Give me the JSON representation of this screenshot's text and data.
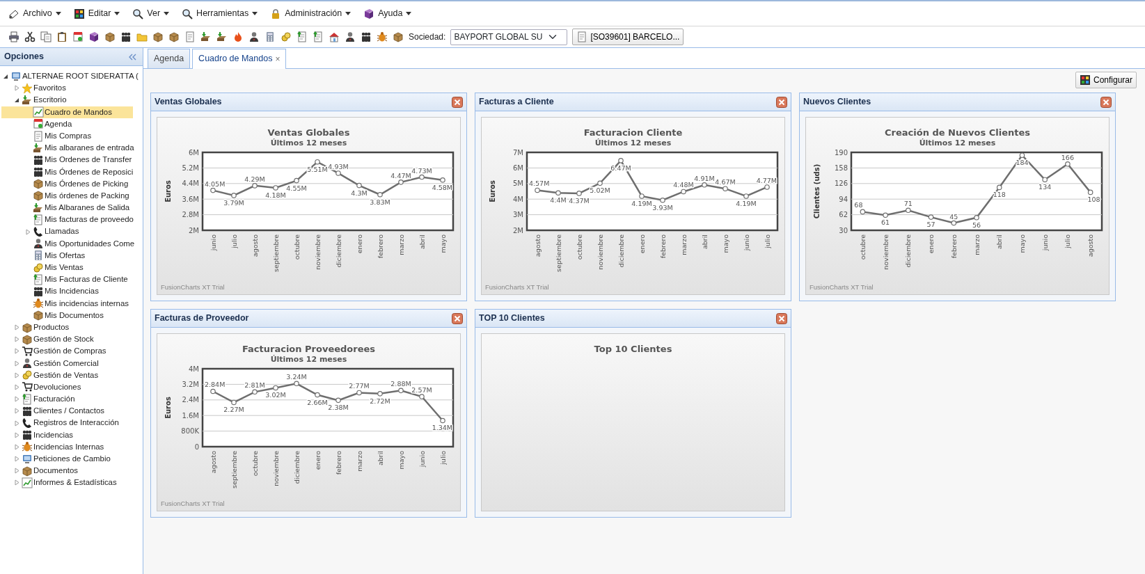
{
  "menu": [
    {
      "label": "Archivo"
    },
    {
      "label": "Editar"
    },
    {
      "label": "Ver"
    },
    {
      "label": "Herramientas"
    },
    {
      "label": "Administración"
    },
    {
      "label": "Ayuda"
    }
  ],
  "toolbar": {
    "company_label": "Sociedad:",
    "company_value": "BAYPORT GLOBAL SU",
    "document_button": "[SO39601] BARCELO..."
  },
  "sidebar": {
    "title": "Opciones",
    "tree": [
      {
        "label": "ALTERNAE ROOT SIDERATTA (",
        "expanded": true,
        "selected": false,
        "children": [
          {
            "label": "Favoritos",
            "expanded": false,
            "selected": false
          },
          {
            "label": "Escritorio",
            "expanded": true,
            "selected": false,
            "children": [
              {
                "label": "Cuadro de Mandos",
                "selected": true
              },
              {
                "label": "Agenda",
                "selected": false
              },
              {
                "label": "Mis Compras",
                "selected": false
              },
              {
                "label": "Mis albaranes de entrada",
                "selected": false
              },
              {
                "label": "Mis Ordenes de Transfer",
                "selected": false
              },
              {
                "label": "Mis Órdenes de Reposici",
                "selected": false
              },
              {
                "label": "Mis Órdenes de Picking",
                "selected": false
              },
              {
                "label": "Mis órdenes de Packing",
                "selected": false
              },
              {
                "label": "Mis Albaranes de Salida",
                "selected": false
              },
              {
                "label": "Mis facturas de proveedo",
                "selected": false
              },
              {
                "label": "Llamadas",
                "expanded": false,
                "selected": false
              },
              {
                "label": "Mis Oportunidades Come",
                "selected": false
              },
              {
                "label": "Mis Ofertas",
                "selected": false
              },
              {
                "label": "Mis Ventas",
                "selected": false
              },
              {
                "label": "Mis Facturas de Cliente",
                "selected": false
              },
              {
                "label": "Mis Incidencias",
                "selected": false
              },
              {
                "label": "Mis incidencias internas",
                "selected": false
              },
              {
                "label": "Mis Documentos",
                "selected": false
              }
            ]
          },
          {
            "label": "Productos",
            "expanded": false,
            "selected": false
          },
          {
            "label": "Gestión de Stock",
            "expanded": false,
            "selected": false
          },
          {
            "label": "Gestión de Compras",
            "expanded": false,
            "selected": false
          },
          {
            "label": "Gestión Comercial",
            "expanded": false,
            "selected": false
          },
          {
            "label": "Gestión de Ventas",
            "expanded": false,
            "selected": false
          },
          {
            "label": "Devoluciones",
            "expanded": false,
            "selected": false
          },
          {
            "label": "Facturación",
            "expanded": false,
            "selected": false
          },
          {
            "label": "Clientes / Contactos",
            "expanded": false,
            "selected": false
          },
          {
            "label": "Registros de Interacción",
            "expanded": false,
            "selected": false
          },
          {
            "label": "Incidencias",
            "expanded": false,
            "selected": false
          },
          {
            "label": "Incidencias Internas",
            "expanded": false,
            "selected": false
          },
          {
            "label": "Peticiones de Cambio",
            "expanded": false,
            "selected": false
          },
          {
            "label": "Documentos",
            "expanded": false,
            "selected": false
          },
          {
            "label": "Informes & Estadísticas",
            "expanded": false,
            "selected": false
          }
        ]
      }
    ]
  },
  "tabs": [
    {
      "label": "Agenda",
      "selected": false
    },
    {
      "label": "Cuadro de Mandos",
      "selected": true,
      "close": "×"
    }
  ],
  "configure_button": "Configurar",
  "panels": [
    {
      "title": "Ventas Globales",
      "subtitle": "Últimos 12 meses",
      "footer_note": "FusionCharts XT Trial",
      "chart_data": {
        "type": "line",
        "title": "Ventas Globales",
        "ylabel": "Euros",
        "grid": true,
        "categories": [
          "junio",
          "julio",
          "agosto",
          "septiembre",
          "octubre",
          "noviembre",
          "diciembre",
          "enero",
          "febrero",
          "marzo",
          "abril",
          "mayo"
        ],
        "series": [
          {
            "color": "#6e6e6e",
            "marker": "circle",
            "values": [
              4050000,
              3790000,
              4290000,
              4180000,
              4550000,
              5510000,
              4930000,
              4300000,
              3830000,
              4470000,
              4730000,
              4580000
            ]
          }
        ],
        "ylim": [
          2000000,
          6000000
        ],
        "yticks": [
          {
            "value": 2000000,
            "label": "2M"
          },
          {
            "value": 2800000,
            "label": "2.8M"
          },
          {
            "value": 3600000,
            "label": "3.6M"
          },
          {
            "value": 4400000,
            "label": "4.4M"
          },
          {
            "value": 5200000,
            "label": "5.2M"
          },
          {
            "value": 6000000,
            "label": "6M"
          }
        ],
        "value_labels": [
          "4.05M",
          "3.79M",
          "4.29M",
          "4.18M",
          "4.55M",
          "5.51M",
          "4.93M",
          "4.3M",
          "3.83M",
          "4.47M",
          "4.73M",
          "4.58M"
        ]
      }
    },
    {
      "title": "Facturas a Cliente",
      "subtitle": "Últimos 12 meses",
      "footer_note": "FusionCharts XT Trial",
      "chart_data": {
        "type": "line",
        "title": "Facturacion Cliente",
        "ylabel": "Euros",
        "grid": true,
        "categories": [
          "agosto",
          "septiembre",
          "octubre",
          "noviembre",
          "diciembre",
          "enero",
          "febrero",
          "marzo",
          "abril",
          "mayo",
          "junio",
          "julio"
        ],
        "series": [
          {
            "color": "#6e6e6e",
            "marker": "circle",
            "values": [
              4570000,
              4400000,
              4370000,
              5020000,
              6470000,
              4190000,
              3930000,
              4480000,
              4910000,
              4670000,
              4190000,
              4770000
            ]
          }
        ],
        "ylim": [
          2000000,
          7000000
        ],
        "yticks": [
          {
            "value": 2000000,
            "label": "2M"
          },
          {
            "value": 3000000,
            "label": "3M"
          },
          {
            "value": 4000000,
            "label": "4M"
          },
          {
            "value": 5000000,
            "label": "5M"
          },
          {
            "value": 6000000,
            "label": "6M"
          },
          {
            "value": 7000000,
            "label": "7M"
          }
        ],
        "value_labels": [
          "4.57M",
          "4.4M",
          "4.37M",
          "5.02M",
          "6.47M",
          "4.19M",
          "3.93M",
          "4.48M",
          "4.91M",
          "4.67M",
          "4.19M",
          "4.77M"
        ]
      }
    },
    {
      "title": "Nuevos Clientes",
      "subtitle": "Últimos 12 meses",
      "footer_note": "FusionCharts XT Trial",
      "chart_data": {
        "type": "line",
        "title": "Creación de Nuevos Clientes",
        "ylabel": "Clientes (uds)",
        "grid": true,
        "categories": [
          "octubre",
          "noviembre",
          "diciembre",
          "enero",
          "febrero",
          "marzo",
          "abril",
          "mayo",
          "junio",
          "julio",
          "agosto"
        ],
        "series": [
          {
            "color": "#6e6e6e",
            "marker": "circle",
            "values": [
              68,
              61,
              71,
              57,
              45,
              56,
              118,
              184,
              134,
              166,
              108
            ]
          }
        ],
        "ylim": [
          30,
          190
        ],
        "yticks": [
          30,
          62,
          94,
          126,
          158,
          190
        ],
        "value_labels": [
          "68",
          "61",
          "71",
          "57",
          "45",
          "56",
          "118",
          "184",
          "134",
          "166",
          "108"
        ]
      }
    },
    {
      "title": "Facturas de Proveedor",
      "subtitle": "Últimos 12 meses",
      "footer_note": "FusionCharts XT Trial",
      "chart_data": {
        "type": "line",
        "title": "Facturacion Proveedorees",
        "ylabel": "Euros",
        "grid": true,
        "categories": [
          "agosto",
          "septiembre",
          "octubre",
          "noviembre",
          "diciembre",
          "enero",
          "febrero",
          "marzo",
          "abril",
          "mayo",
          "junio",
          "julio"
        ],
        "series": [
          {
            "color": "#6e6e6e",
            "marker": "circle",
            "values": [
              2840000,
              2270000,
              2810000,
              3020000,
              3240000,
              2660000,
              2380000,
              2770000,
              2720000,
              2880000,
              2570000,
              1340000
            ]
          }
        ],
        "ylim": [
          0,
          4000000
        ],
        "yticks": [
          {
            "value": 0,
            "label": "0"
          },
          {
            "value": 800000,
            "label": "800K"
          },
          {
            "value": 1600000,
            "label": "1.6M"
          },
          {
            "value": 2400000,
            "label": "2.4M"
          },
          {
            "value": 3200000,
            "label": "3.2M"
          },
          {
            "value": 4000000,
            "label": "4M"
          }
        ],
        "value_labels": [
          "2.84M",
          "2.27M",
          "2.81M",
          "3.02M",
          "3.24M",
          "2.66M",
          "2.38M",
          "2.77M",
          "2.72M",
          "2.88M",
          "2.57M",
          "1.34M"
        ]
      }
    },
    {
      "title": "TOP 10 Clientes",
      "chart_title": "Top 10 Clientes"
    }
  ]
}
